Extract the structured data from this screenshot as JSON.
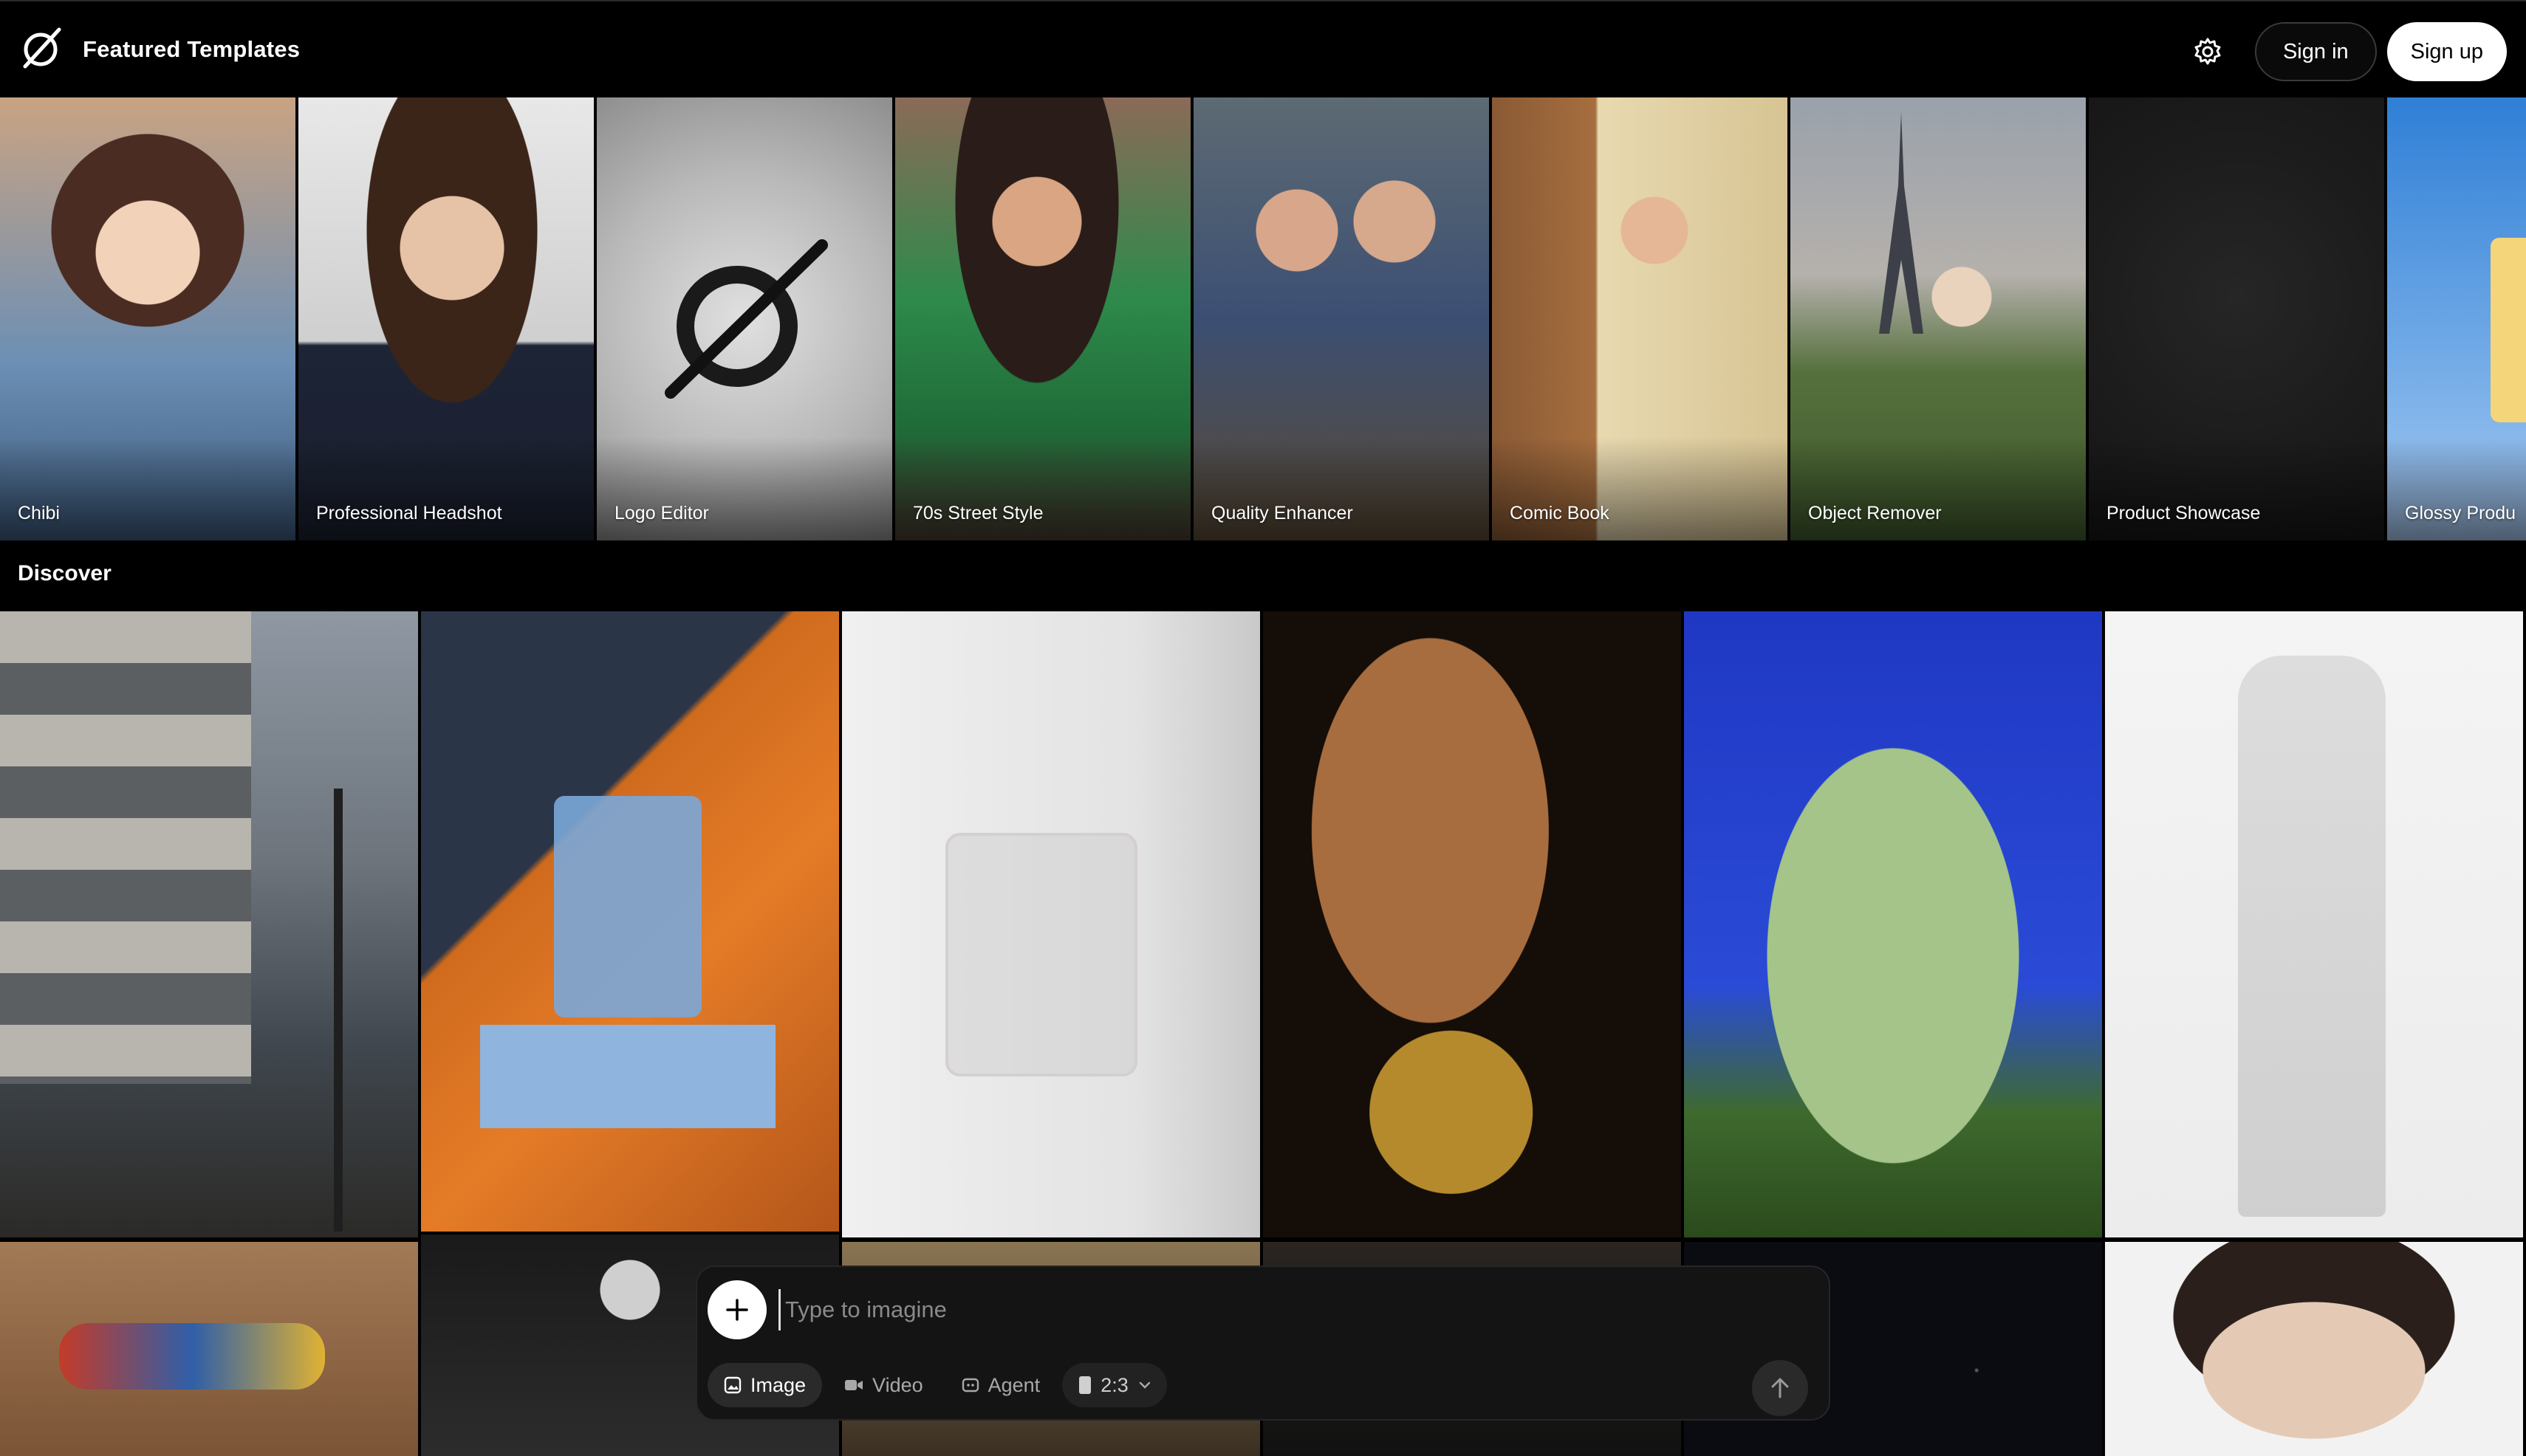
{
  "header": {
    "title": "Featured Templates",
    "settings_icon": "gear-icon",
    "signin_label": "Sign in",
    "signup_label": "Sign up"
  },
  "featured": {
    "tiles": [
      {
        "label": "Chibi"
      },
      {
        "label": "Professional Headshot"
      },
      {
        "label": "Logo Editor"
      },
      {
        "label": "70s Street Style"
      },
      {
        "label": "Quality Enhancer"
      },
      {
        "label": "Comic Book"
      },
      {
        "label": "Object Remover"
      },
      {
        "label": "Product Showcase"
      },
      {
        "label": "Glossy Produ"
      }
    ]
  },
  "discover": {
    "title": "Discover"
  },
  "composer": {
    "placeholder": "Type to imagine",
    "modes": {
      "image": "Image",
      "video": "Video",
      "agent": "Agent"
    },
    "ratio": "2:3"
  },
  "colors": {
    "background": "#000000",
    "composer_bg": "#141414",
    "accent_white": "#ffffff"
  }
}
